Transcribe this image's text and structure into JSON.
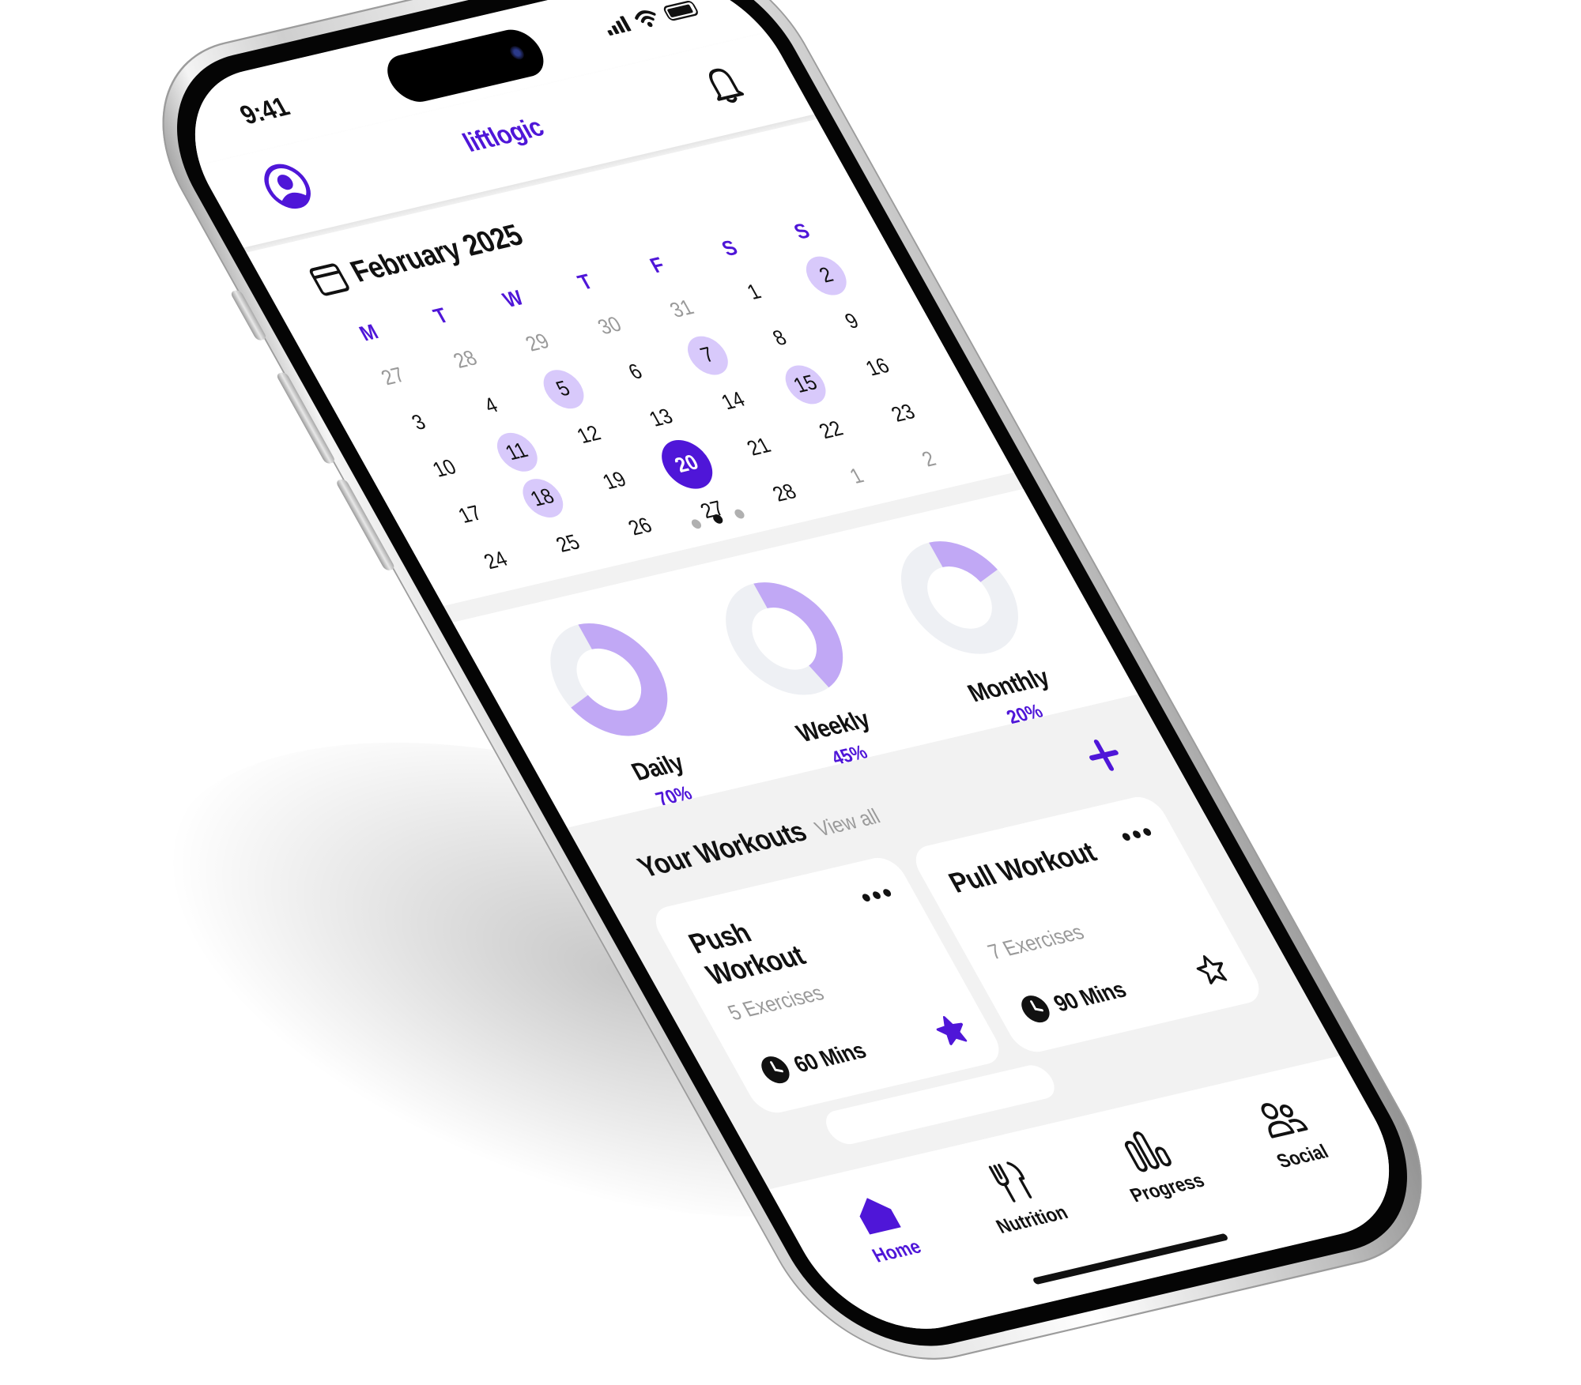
{
  "status_bar": {
    "time": "9:41"
  },
  "app_bar": {
    "brand": "liftlogic"
  },
  "calendar": {
    "title": "February 2025",
    "weekdays": [
      "M",
      "T",
      "W",
      "T",
      "F",
      "S",
      "S"
    ],
    "days": [
      {
        "n": "27",
        "state": "muted"
      },
      {
        "n": "28",
        "state": "muted"
      },
      {
        "n": "29",
        "state": "muted"
      },
      {
        "n": "30",
        "state": "muted"
      },
      {
        "n": "31",
        "state": "muted"
      },
      {
        "n": "1",
        "state": ""
      },
      {
        "n": "2",
        "state": "hl"
      },
      {
        "n": "3",
        "state": ""
      },
      {
        "n": "4",
        "state": ""
      },
      {
        "n": "5",
        "state": "hl"
      },
      {
        "n": "6",
        "state": ""
      },
      {
        "n": "7",
        "state": "hl"
      },
      {
        "n": "8",
        "state": ""
      },
      {
        "n": "9",
        "state": ""
      },
      {
        "n": "10",
        "state": ""
      },
      {
        "n": "11",
        "state": "hl"
      },
      {
        "n": "12",
        "state": ""
      },
      {
        "n": "13",
        "state": ""
      },
      {
        "n": "14",
        "state": ""
      },
      {
        "n": "15",
        "state": "hl"
      },
      {
        "n": "16",
        "state": ""
      },
      {
        "n": "17",
        "state": ""
      },
      {
        "n": "18",
        "state": "hl"
      },
      {
        "n": "19",
        "state": ""
      },
      {
        "n": "20",
        "state": "sel"
      },
      {
        "n": "21",
        "state": ""
      },
      {
        "n": "22",
        "state": ""
      },
      {
        "n": "23",
        "state": ""
      },
      {
        "n": "24",
        "state": ""
      },
      {
        "n": "25",
        "state": ""
      },
      {
        "n": "26",
        "state": ""
      },
      {
        "n": "27",
        "state": ""
      },
      {
        "n": "28",
        "state": ""
      },
      {
        "n": "1",
        "state": "muted"
      },
      {
        "n": "2",
        "state": "muted"
      }
    ],
    "page_count": 3,
    "current_page": 2
  },
  "goals": [
    {
      "label": "Daily",
      "percent": "70%",
      "value": 0.7
    },
    {
      "label": "Weekly",
      "percent": "45%",
      "value": 0.45
    },
    {
      "label": "Monthly",
      "percent": "20%",
      "value": 0.2
    }
  ],
  "workouts": {
    "title": "Your Workouts",
    "view_all": "View all",
    "cards": [
      {
        "name": "Push Workout",
        "exercises": "5 Exercises",
        "duration": "60 Mins",
        "favorite": true
      },
      {
        "name": "Pull Workout",
        "exercises": "7 Exercises",
        "duration": "90 Mins",
        "favorite": false
      }
    ]
  },
  "tabs": [
    {
      "label": "Home",
      "icon": "home-icon",
      "active": true
    },
    {
      "label": "Nutrition",
      "icon": "nutrition-icon",
      "active": false
    },
    {
      "label": "Progress",
      "icon": "progress-icon",
      "active": false
    },
    {
      "label": "Social",
      "icon": "social-icon",
      "active": false
    }
  ],
  "colors": {
    "accent": "#4f16d8",
    "highlight": "#d8c9fb",
    "ring_fill": "#c1a8f5",
    "ring_track": "#eef0f4"
  }
}
